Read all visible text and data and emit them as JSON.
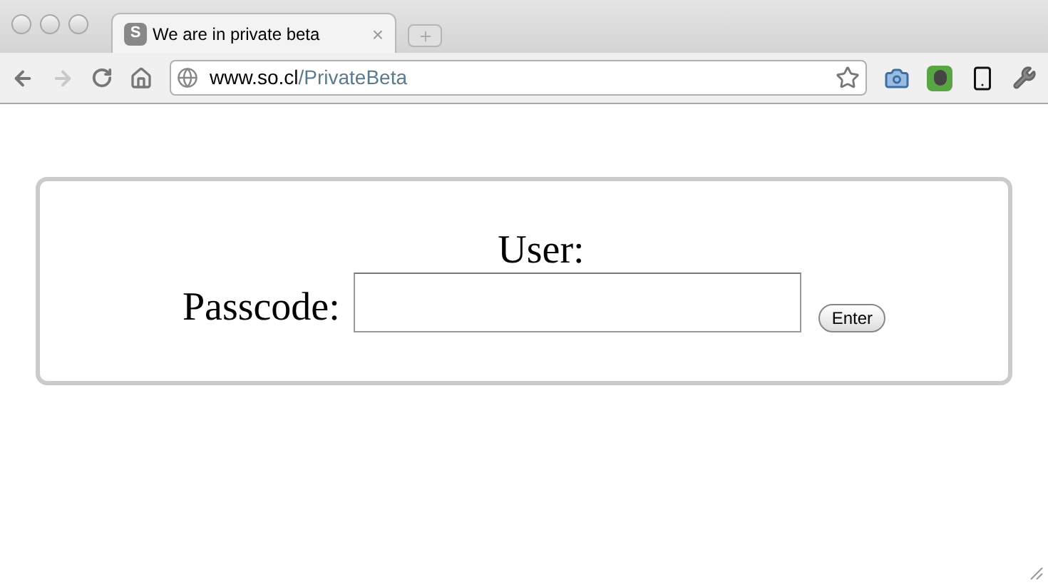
{
  "tab": {
    "favicon": "S",
    "title": "We are in private beta",
    "close": "×"
  },
  "address": {
    "host": "www.so.cl",
    "path": "/PrivateBeta"
  },
  "form": {
    "user_label": "User:",
    "passcode_label": "Passcode:",
    "button": "Enter"
  }
}
